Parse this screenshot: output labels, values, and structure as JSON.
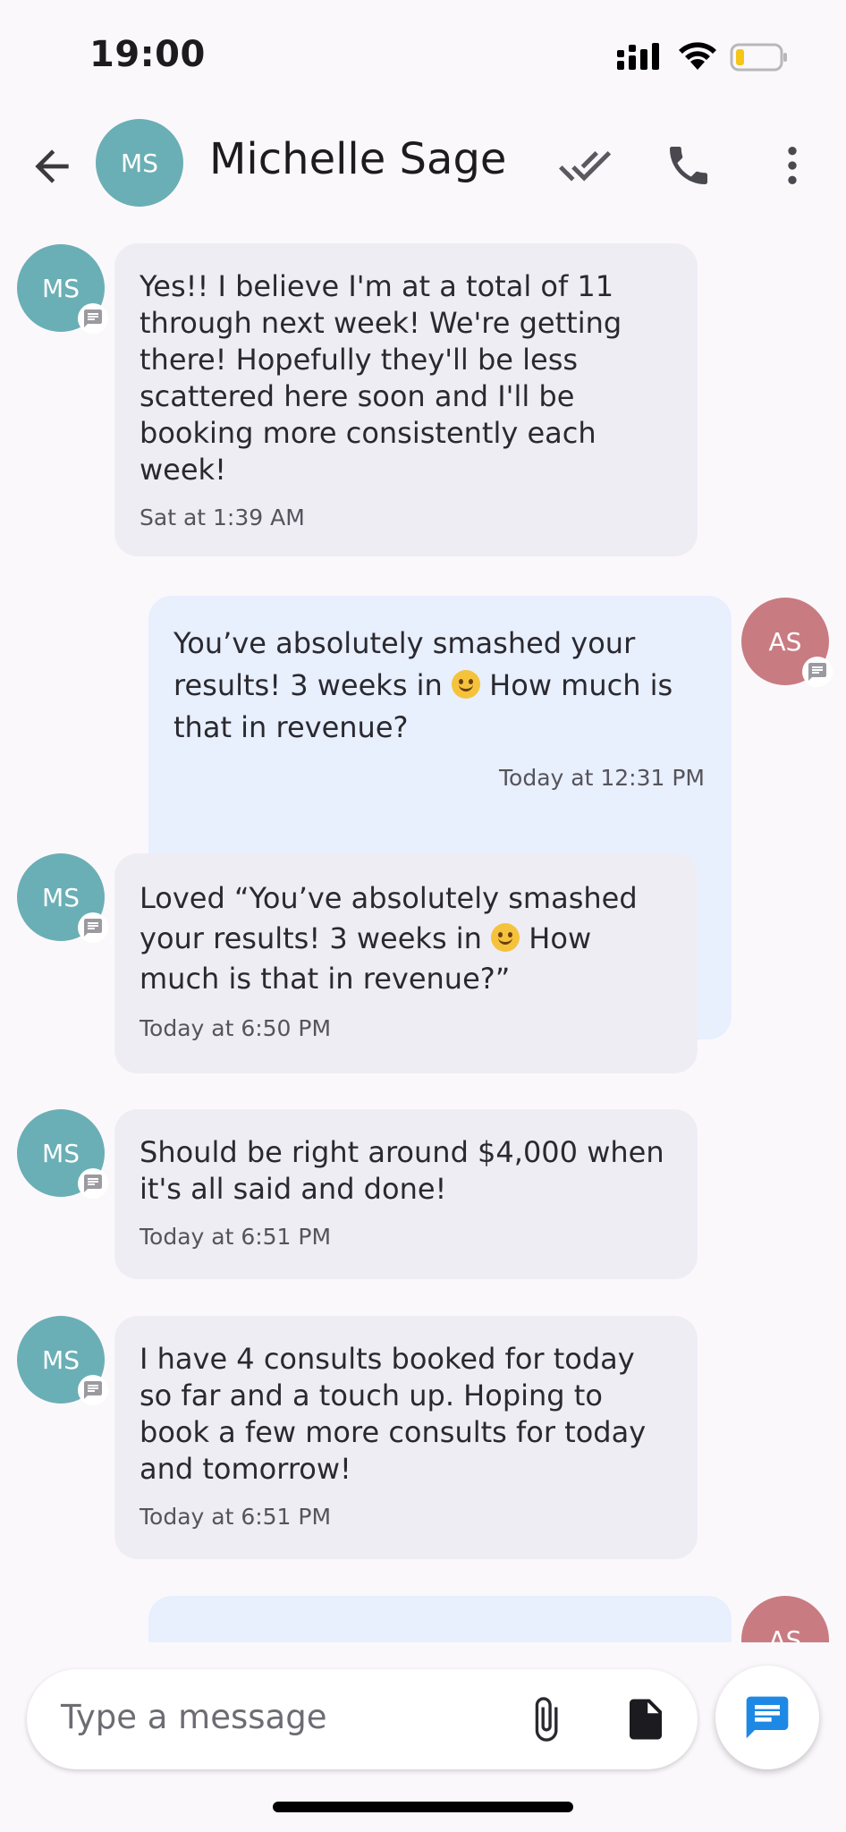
{
  "status_bar": {
    "time": "19:00"
  },
  "header": {
    "avatar_initials": "MS",
    "contact_name": "Michelle Sage"
  },
  "messages": [
    {
      "direction": "in",
      "initials": "MS",
      "text": "Yes!! I believe I'm at a total of 11 through next week! We're getting there! Hopefully they'll be less scattered here soon and I'll be booking more consistently each week!",
      "time": "Sat at 1:39 AM"
    },
    {
      "direction": "out",
      "initials": "AS",
      "text_before": "You’ve absolutely smashed your results! 3 weeks in ",
      "emoji": "smiling-face",
      "text_after": " How much is that in revenue?",
      "time": "Today at 12:31 PM"
    },
    {
      "direction": "in",
      "initials": "MS",
      "text_before": "Loved “You’ve absolutely smashed your results! 3 weeks in ",
      "emoji": "smiling-face",
      "text_after": " How much is that in revenue?”",
      "time": "Today at 6:50 PM"
    },
    {
      "direction": "in",
      "initials": "MS",
      "text": "Should be right around $4,000 when it's all said and done!",
      "time": "Today at 6:51 PM"
    },
    {
      "direction": "in",
      "initials": "MS",
      "text": "I have 4 consults booked for today so far and a touch up. Hoping to book a few more consults for today and tomorrow!",
      "time": "Today at 6:51 PM"
    },
    {
      "direction": "out",
      "initials": "AS",
      "text": "",
      "time": ""
    }
  ],
  "composer": {
    "placeholder": "Type a message"
  },
  "colors": {
    "incoming_bubble": "#efedf4",
    "outgoing_bubble": "#e8effd",
    "ms_avatar": "#6aafb5",
    "as_avatar": "#c97b82",
    "send_accent": "#1e88e5"
  }
}
